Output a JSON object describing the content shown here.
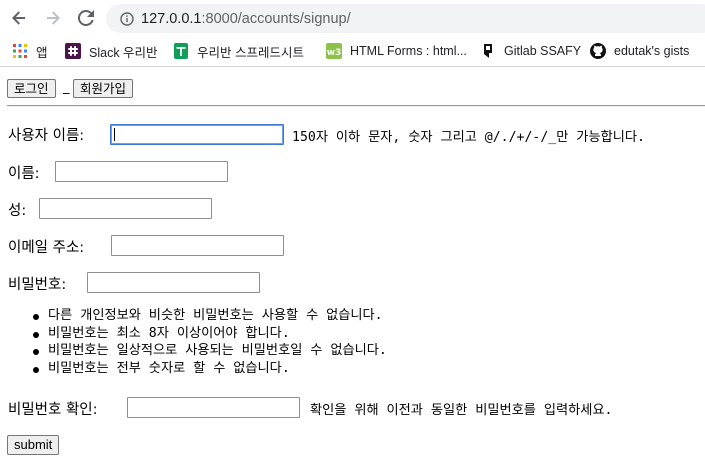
{
  "browser": {
    "url_host": "127.0.0.1",
    "url_rest": ":8000/accounts/signup/",
    "bookmarks": [
      {
        "label": "앱",
        "icon": "apps-grid-icon"
      },
      {
        "label": "Slack 우리반",
        "icon": "slack-icon"
      },
      {
        "label": "우리반 스프레드시트",
        "icon": "sheets-icon"
      },
      {
        "label": "HTML Forms : html...",
        "icon": "w3schools-icon"
      },
      {
        "label": "Gitlab SSAFY",
        "icon": "gitlab-icon"
      },
      {
        "label": "edutak's gists",
        "icon": "github-icon"
      }
    ]
  },
  "nav": {
    "login": "로그인",
    "separator": "_",
    "signup": "회원가입"
  },
  "form": {
    "username": {
      "label": "사용자 이름:",
      "value": "",
      "help": "150자 이하 문자, 숫자 그리고 @/./+/-/_만 가능합니다."
    },
    "first_name": {
      "label": "이름:",
      "value": ""
    },
    "last_name": {
      "label": "성:",
      "value": ""
    },
    "email": {
      "label": "이메일 주소:",
      "value": ""
    },
    "password1": {
      "label": "비밀번호:",
      "value": "",
      "rules": [
        "다른 개인정보와 비슷한 비밀번호는 사용할 수 없습니다.",
        "비밀번호는 최소 8자 이상이어야 합니다.",
        "비밀번호는 일상적으로 사용되는 비밀번호일 수 없습니다.",
        "비밀번호는 전부 숫자로 할 수 없습니다."
      ]
    },
    "password2": {
      "label": "비밀번호 확인:",
      "value": "",
      "help": "확인을 위해 이전과 동일한 비밀번호를 입력하세요."
    },
    "submit": "submit"
  },
  "colors": {
    "focus_border": "#3b78d8",
    "omnibox_bg": "#f1f3f4"
  }
}
